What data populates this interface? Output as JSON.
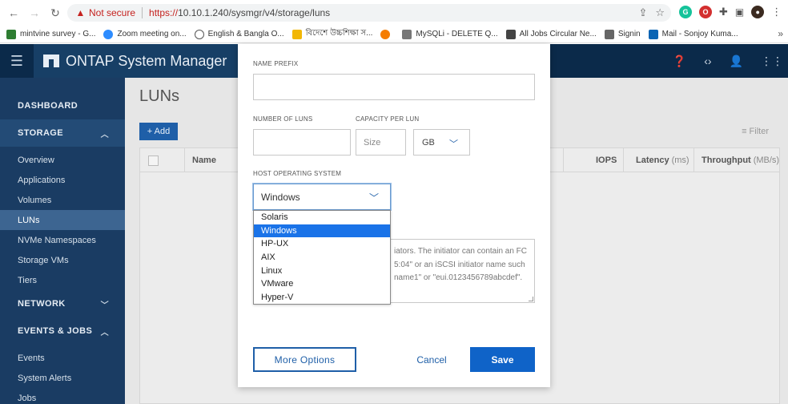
{
  "browser": {
    "not_secure": "Not secure",
    "url_scheme": "https://",
    "url_rest": "10.10.1.240/sysmgr/v4/storage/luns",
    "bookmarks": [
      {
        "label": "mintvine survey - G...",
        "color": "#2e7d32"
      },
      {
        "label": "Zoom meeting on...",
        "color": "#2d8cff"
      },
      {
        "label": "English & Bangla O...",
        "color": "#555555"
      },
      {
        "label": "বিদেশে উচ্চশিক্ষা স...",
        "color": "#f2b705"
      },
      {
        "label": "",
        "color": "#f57c00"
      },
      {
        "label": "MySQLi - DELETE Q...",
        "color": "#777777"
      },
      {
        "label": "All Jobs Circular Ne...",
        "color": "#444444"
      },
      {
        "label": "Signin",
        "color": "#666666"
      },
      {
        "label": "Mail - Sonjoy Kuma...",
        "color": "#0a64b4"
      }
    ],
    "more": "»"
  },
  "app": {
    "title": "ONTAP System Manager",
    "accent": "#0f63c8"
  },
  "sidebar": {
    "dashboard": "DASHBOARD",
    "storage": "STORAGE",
    "storage_items": [
      "Overview",
      "Applications",
      "Volumes",
      "LUNs",
      "NVMe Namespaces",
      "Storage VMs",
      "Tiers"
    ],
    "network": "NETWORK",
    "events_jobs": "EVENTS & JOBS",
    "events_items": [
      "Events",
      "System Alerts",
      "Jobs"
    ]
  },
  "page": {
    "title": "LUNs",
    "add_label": "+ Add",
    "filter_label": "Filter",
    "columns": {
      "name": "Name",
      "iops": "IOPS",
      "latency": "Latency",
      "latency_unit": "(ms)",
      "throughput": "Throughput",
      "throughput_unit": "(MB/s)"
    }
  },
  "modal": {
    "name_prefix_label": "NAME PREFIX",
    "name_prefix_value": "",
    "num_luns_label": "NUMBER OF LUNS",
    "num_luns_value": "",
    "capacity_label": "CAPACITY PER LUN",
    "capacity_placeholder": "Size",
    "capacity_unit": "GB",
    "host_os_label": "HOST OPERATING SYSTEM",
    "host_os_value": "Windows",
    "os_options": [
      "Solaris",
      "Windows",
      "HP-UX",
      "AIX",
      "Linux",
      "VMware",
      "Hyper-V"
    ],
    "initiator_help": [
      "iators. The initiator can contain an FC",
      "5:04\" or an iSCSI initiator name such",
      "name1\" or \"eui.0123456789abcdef\"."
    ],
    "more_options": "More Options",
    "cancel": "Cancel",
    "save": "Save"
  }
}
